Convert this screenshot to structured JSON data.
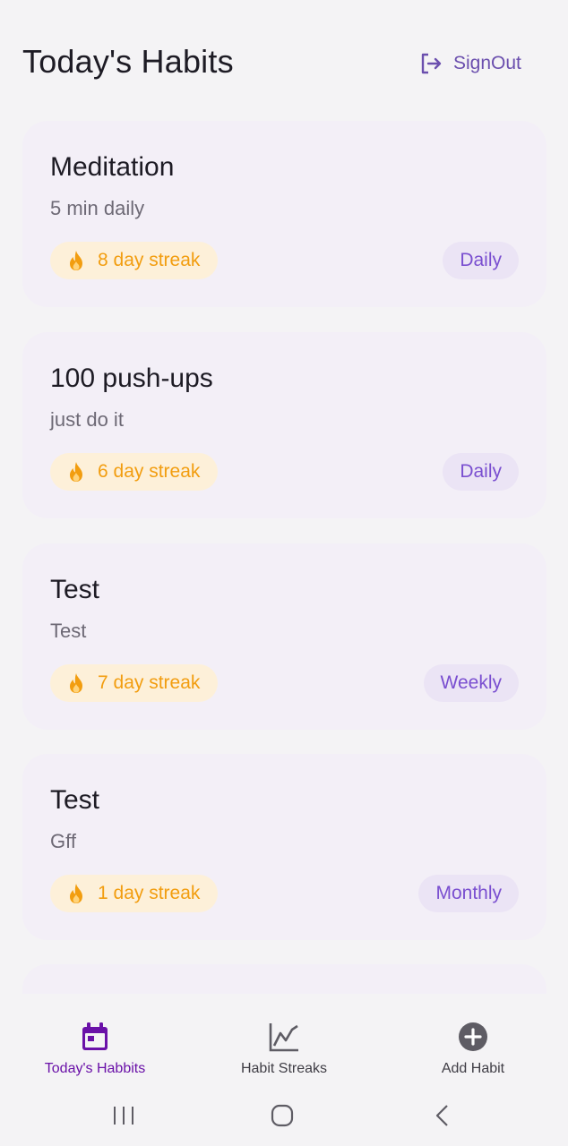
{
  "header": {
    "title": "Today's Habits",
    "signout_label": "SignOut",
    "signout_icon": "logout-icon"
  },
  "habits": [
    {
      "title": "Meditation",
      "description": "5 min daily",
      "streak": "8 day streak",
      "frequency": "Daily"
    },
    {
      "title": "100 push-ups",
      "description": "just do it",
      "streak": "6 day streak",
      "frequency": "Daily"
    },
    {
      "title": "Test",
      "description": "Test",
      "streak": "7 day streak",
      "frequency": "Weekly"
    },
    {
      "title": "Test",
      "description": "Gff",
      "streak": "1 day streak",
      "frequency": "Monthly"
    }
  ],
  "bottom_nav": {
    "items": [
      {
        "label": "Today's Habbits",
        "icon": "calendar-icon",
        "active": true
      },
      {
        "label": "Habit Streaks",
        "icon": "chart-icon",
        "active": false
      },
      {
        "label": "Add Habit",
        "icon": "add-circle-icon",
        "active": false
      }
    ]
  },
  "colors": {
    "background": "#f4f3f5",
    "card": "#f3eff7",
    "accent": "#6a11a8",
    "streak_bg": "#fdf0d9",
    "streak_text": "#f29d0f",
    "freq_bg": "#ebe4f5",
    "freq_text": "#7a4fd0"
  }
}
